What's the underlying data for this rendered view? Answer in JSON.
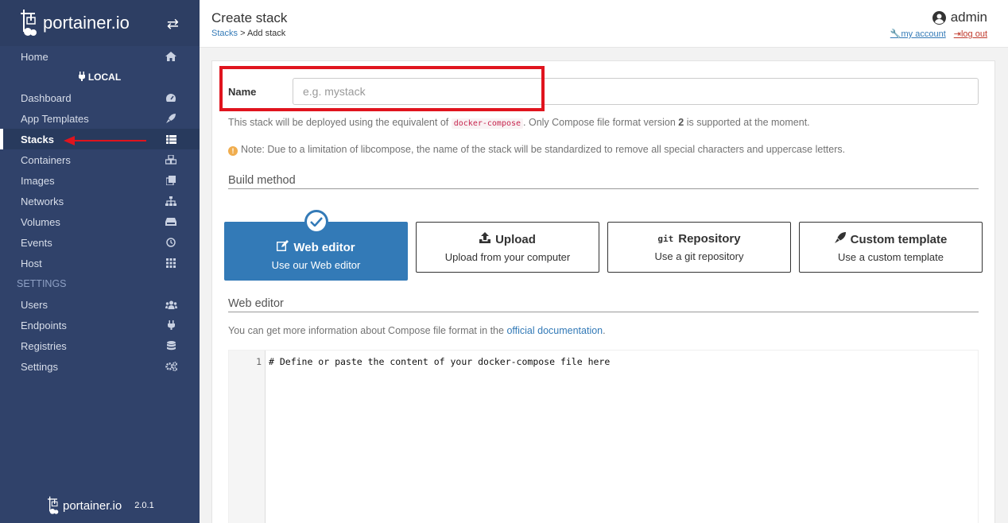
{
  "sidebar": {
    "brand": "portainer.io",
    "items_top": [
      {
        "label": "Home",
        "icon": "home-icon"
      }
    ],
    "endpoint": "LOCAL",
    "items_endpoint": [
      {
        "label": "Dashboard",
        "icon": "dashboard-icon"
      },
      {
        "label": "App Templates",
        "icon": "rocket-icon"
      },
      {
        "label": "Stacks",
        "icon": "list-icon",
        "active": true
      },
      {
        "label": "Containers",
        "icon": "cubes-icon"
      },
      {
        "label": "Images",
        "icon": "clone-icon"
      },
      {
        "label": "Networks",
        "icon": "sitemap-icon"
      },
      {
        "label": "Volumes",
        "icon": "hdd-icon"
      },
      {
        "label": "Events",
        "icon": "history-icon"
      },
      {
        "label": "Host",
        "icon": "th-icon"
      }
    ],
    "settings_section": "SETTINGS",
    "items_settings": [
      {
        "label": "Users",
        "icon": "users-icon"
      },
      {
        "label": "Endpoints",
        "icon": "plug-icon"
      },
      {
        "label": "Registries",
        "icon": "database-icon"
      },
      {
        "label": "Settings",
        "icon": "cogs-icon"
      }
    ],
    "footer_brand": "portainer.io",
    "version": "2.0.1"
  },
  "header": {
    "title": "Create stack",
    "breadcrumb_link": "Stacks",
    "breadcrumb_current": "> Add stack",
    "user": "admin",
    "my_account": "my account",
    "log_out": "log out"
  },
  "form": {
    "name_label": "Name",
    "name_placeholder": "e.g. mystack",
    "help_prefix": "This stack will be deployed using the equivalent of",
    "help_code": "docker-compose",
    "help_mid": ". Only Compose file format version",
    "help_version": "2",
    "help_suffix": "is supported at the moment.",
    "note": "Note: Due to a limitation of libcompose, the name of the stack will be standardized to remove all special characters and uppercase letters."
  },
  "build": {
    "section_title": "Build method",
    "methods": [
      {
        "title": "Web editor",
        "desc": "Use our Web editor",
        "icon": "edit-icon",
        "selected": true
      },
      {
        "title": "Upload",
        "desc": "Upload from your computer",
        "icon": "upload-icon"
      },
      {
        "title": "Repository",
        "desc": "Use a git repository",
        "icon": "git-icon",
        "icon_text": "git"
      },
      {
        "title": "Custom template",
        "desc": "Use a custom template",
        "icon": "rocket-icon"
      }
    ]
  },
  "editor": {
    "section_title": "Web editor",
    "info_prefix": "You can get more information about Compose file format in the",
    "info_link": "official documentation",
    "info_suffix": ".",
    "line_number": "1",
    "line_text": "# Define or paste the content of your docker-compose file here"
  },
  "colors": {
    "sidebar_bg": "#30426a",
    "accent": "#337ab7",
    "highlight_red": "#e0141e"
  }
}
